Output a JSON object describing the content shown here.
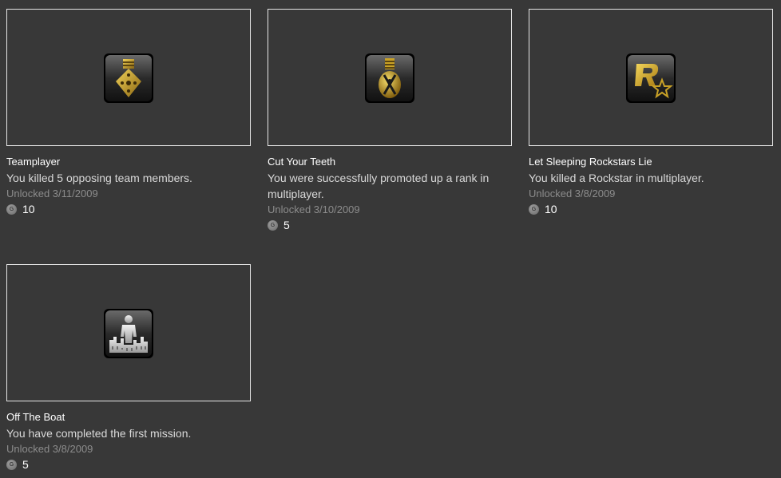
{
  "achievements": [
    {
      "title": "Teamplayer",
      "description": "You killed 5 opposing team members.",
      "unlocked": "Unlocked 3/11/2009",
      "gamerscore": "10",
      "icon": "cross-medal-icon"
    },
    {
      "title": "Cut Your Teeth",
      "description": "You were successfully promoted up a rank in multiplayer.",
      "unlocked": "Unlocked 3/10/2009",
      "gamerscore": "5",
      "icon": "round-medal-icon"
    },
    {
      "title": "Let Sleeping Rockstars Lie",
      "description": "You killed a Rockstar in multiplayer.",
      "unlocked": "Unlocked 3/8/2009",
      "gamerscore": "10",
      "icon": "rockstar-logo-icon"
    },
    {
      "title": "Off The Boat",
      "description": "You have completed the first mission.",
      "unlocked": "Unlocked 3/8/2009",
      "gamerscore": "5",
      "icon": "person-skyline-icon"
    }
  ],
  "gamerscore_icon_letter": "G",
  "colors": {
    "background": "#383838",
    "frame_border": "#e6e6e6",
    "gold": "#c9a227"
  }
}
